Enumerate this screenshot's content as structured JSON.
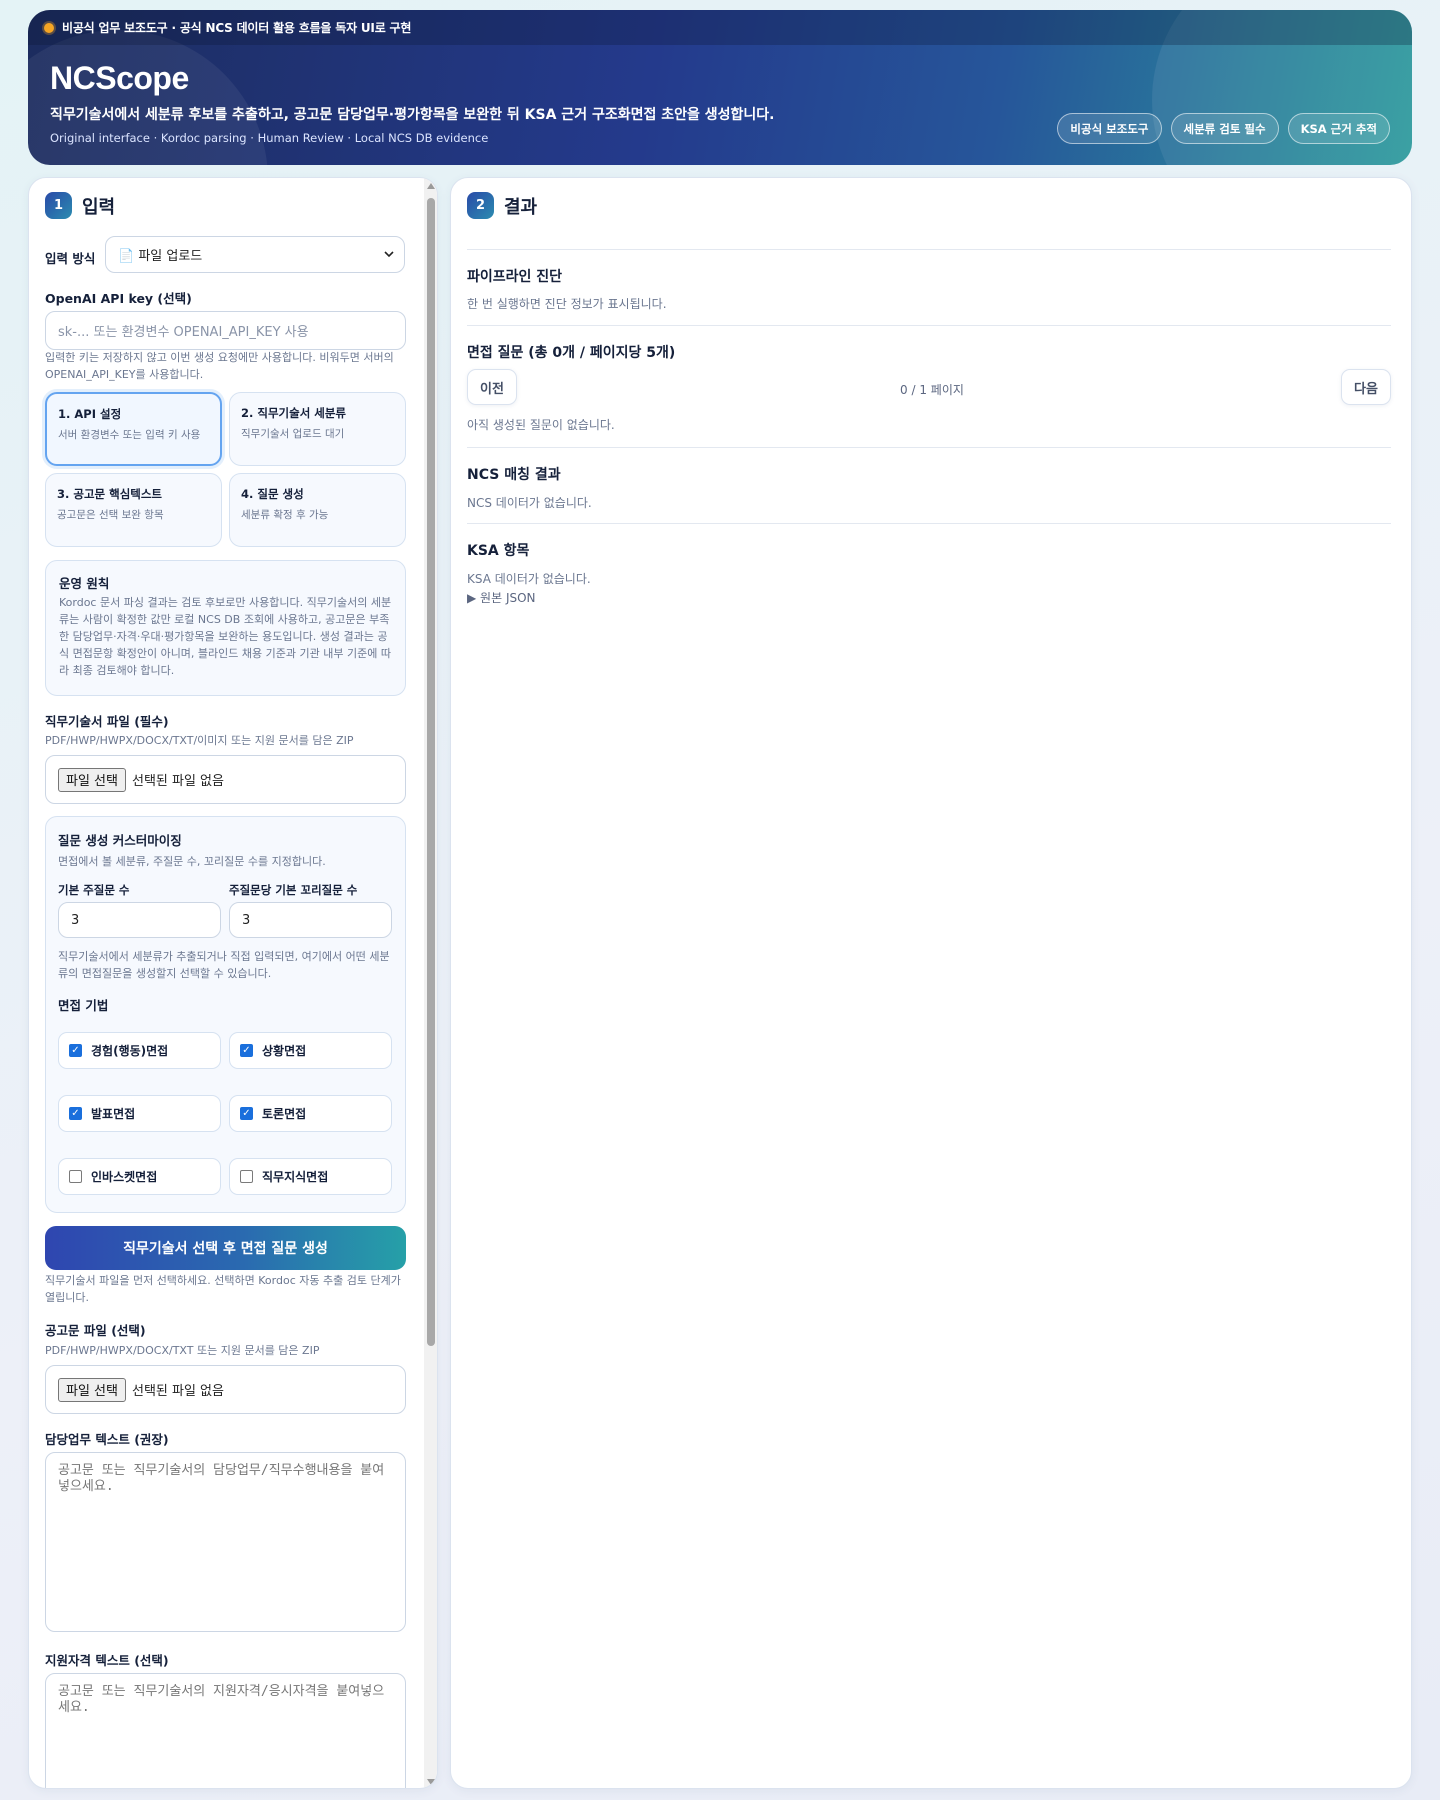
{
  "header": {
    "notice": "비공식 업무 보조도구 · 공식 NCS 데이터 활용 흐름을 독자 UI로 구현",
    "title": "NCScope",
    "subtitle": "직무기술서에서 세분류 후보를 추출하고, 공고문 담당업무·평가항목을 보완한 뒤 KSA 근거 구조화면접 초안을 생성합니다.",
    "meta": "Original interface · Kordoc parsing · Human Review · Local NCS DB evidence",
    "badges": [
      "비공식 보조도구",
      "세분류 검토 필수",
      "KSA 근거 추적"
    ]
  },
  "input_panel": {
    "step_number": "1",
    "title": "입력",
    "input_mode_label": "입력 방식",
    "input_mode_value": "📄 파일 업로드",
    "api_key_label": "OpenAI API key (선택)",
    "api_key_placeholder": "sk-... 또는 환경변수 OPENAI_API_KEY 사용",
    "api_key_help": "입력한 키는 저장하지 않고 이번 생성 요청에만 사용합니다. 비워두면 서버의 OPENAI_API_KEY를 사용합니다.",
    "steps": [
      {
        "title": "1. API 설정",
        "desc": "서버 환경변수 또는 입력 키 사용",
        "active": true
      },
      {
        "title": "2. 직무기술서 세분류",
        "desc": "직무기술서 업로드 대기",
        "active": false
      },
      {
        "title": "3. 공고문 핵심텍스트",
        "desc": "공고문은 선택 보완 항목",
        "active": false
      },
      {
        "title": "4. 질문 생성",
        "desc": "세분류 확정 후 가능",
        "active": false
      }
    ],
    "principle_title": "운영 원칙",
    "principle_text": "Kordoc 문서 파싱 결과는 검토 후보로만 사용합니다. 직무기술서의 세분류는 사람이 확정한 값만 로컬 NCS DB 조회에 사용하고, 공고문은 부족한 담당업무·자격·우대·평가항목을 보완하는 용도입니다. 생성 결과는 공식 면접문항 확정안이 아니며, 블라인드 채용 기준과 기관 내부 기준에 따라 최종 검토해야 합니다.",
    "jd_file_label": "직무기술서 파일 (필수)",
    "jd_file_help": "PDF/HWP/HWPX/DOCX/TXT/이미지 또는 지원 문서를 담은 ZIP",
    "file_button": "파일 선택",
    "no_file": "선택된 파일 없음",
    "custom_title": "질문 생성 커스터마이징",
    "custom_help": "면접에서 볼 세분류, 주질문 수, 꼬리질문 수를 지정합니다.",
    "main_q_label": "기본 주질문 수",
    "main_q_value": "3",
    "follow_q_label": "주질문당 기본 꼬리질문 수",
    "follow_q_value": "3",
    "custom_note": "직무기술서에서 세분류가 추출되거나 직접 입력되면, 여기에서 어떤 세분류의 면접질문을 생성할지 선택할 수 있습니다.",
    "methods_title": "면접 기법",
    "methods": [
      {
        "label": "경험(행동)면접",
        "checked": true
      },
      {
        "label": "상황면접",
        "checked": true
      },
      {
        "label": "발표면접",
        "checked": true
      },
      {
        "label": "토론면접",
        "checked": true
      },
      {
        "label": "인바스켓면접",
        "checked": false
      },
      {
        "label": "직무지식면접",
        "checked": false
      }
    ],
    "generate_button": "직무기술서 선택 후 면접 질문 생성",
    "generate_help": "직무기술서 파일을 먼저 선택하세요. 선택하면 Kordoc 자동 추출 검토 단계가 열립니다.",
    "notice_file_label": "공고문 파일 (선택)",
    "notice_file_help": "PDF/HWP/HWPX/DOCX/TXT 또는 지원 문서를 담은 ZIP",
    "duty_label": "담당업무 텍스트 (권장)",
    "duty_placeholder": "공고문 또는 직무기술서의 담당업무/직무수행내용을 붙여넣으세요.",
    "qual_label": "지원자격 텍스트 (선택)",
    "qual_placeholder": "공고문 또는 직무기술서의 지원자격/응시자격을 붙여넣으세요."
  },
  "result_panel": {
    "step_number": "2",
    "title": "결과",
    "diag_title": "파이프라인 진단",
    "diag_text": "한 번 실행하면 진단 정보가 표시됩니다.",
    "questions_title": "면접 질문 (총 0개 / 페이지당 5개)",
    "prev_button": "이전",
    "page_info": "0 / 1 페이지",
    "next_button": "다음",
    "no_questions": "아직 생성된 질문이 없습니다.",
    "ncs_title": "NCS 매칭 결과",
    "ncs_text": "NCS 데이터가 없습니다.",
    "ksa_title": "KSA 항목",
    "ksa_text": "KSA 데이터가 없습니다.",
    "raw_json": "▶ 원본 JSON"
  },
  "colors": {
    "accent": "#2a4aa8",
    "teal": "#2d9a9c",
    "status_dot": "#f5a524"
  }
}
